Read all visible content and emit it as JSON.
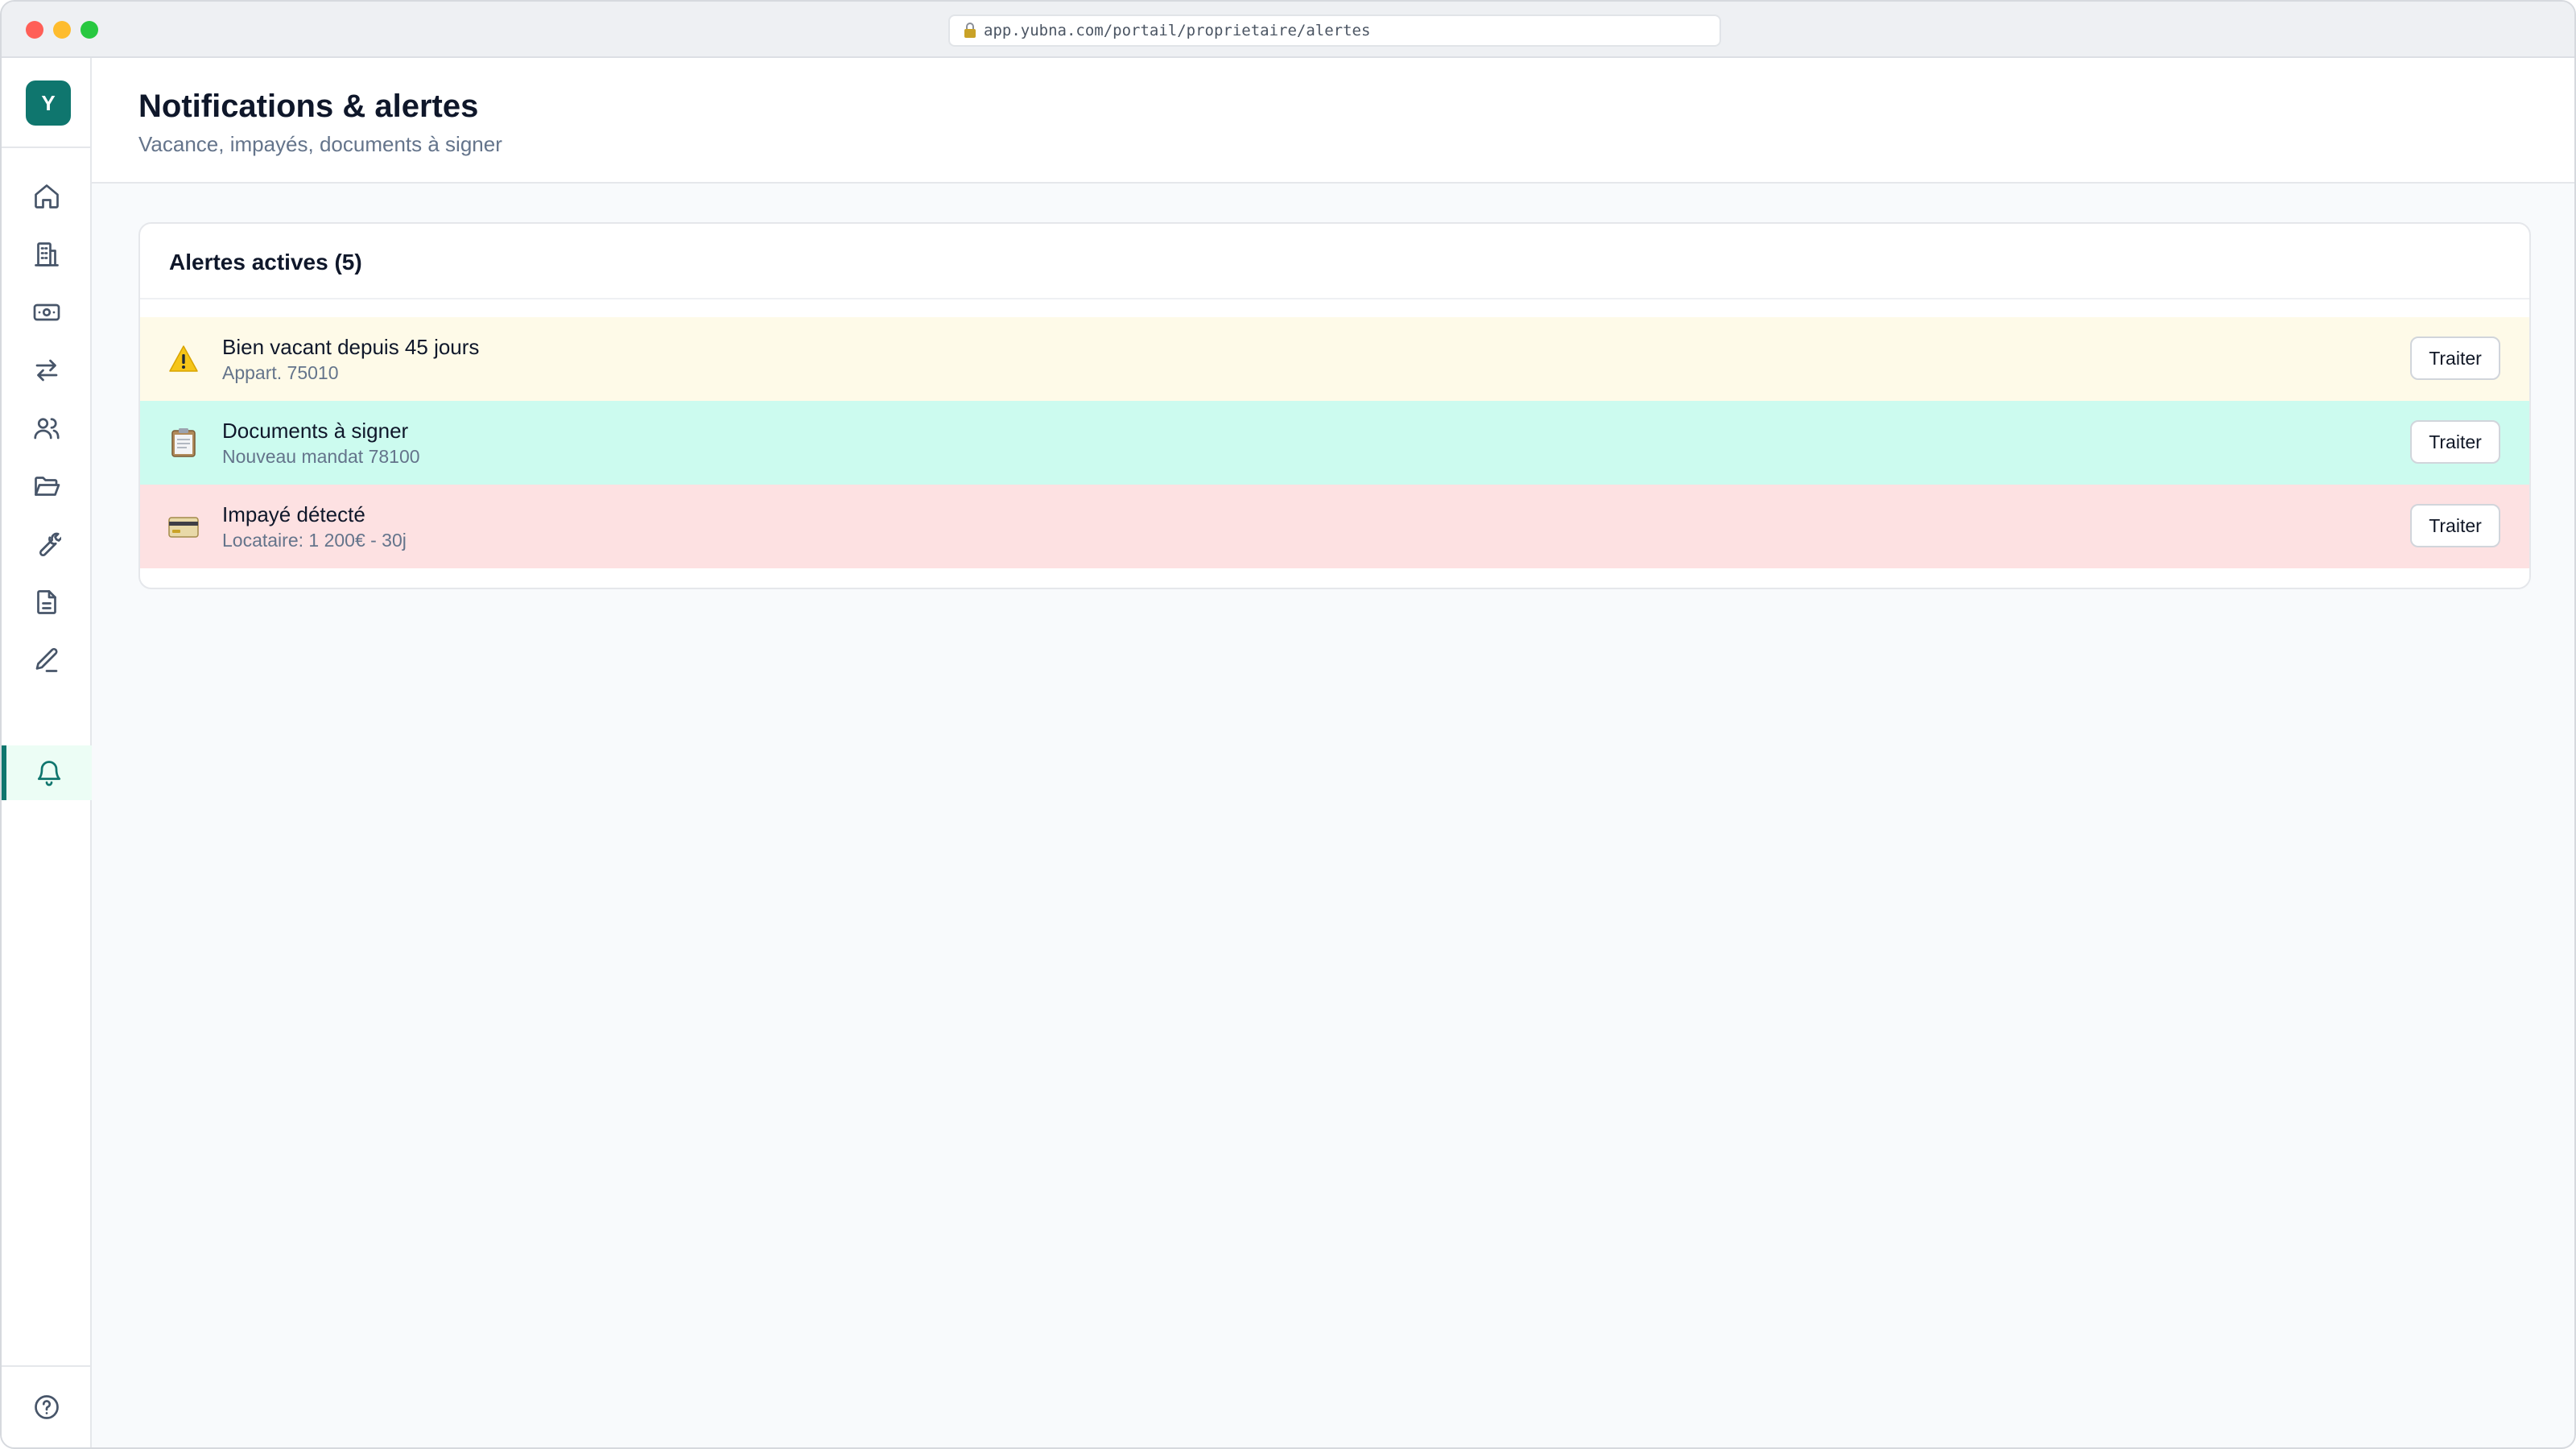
{
  "browser": {
    "url": "app.yubna.com/portail/proprietaire/alertes"
  },
  "sidebar": {
    "logo_letter": "Y",
    "items": [
      {
        "icon": "home-icon"
      },
      {
        "icon": "building-icon"
      },
      {
        "icon": "money-icon"
      },
      {
        "icon": "transfer-arrows-icon"
      },
      {
        "icon": "users-icon"
      },
      {
        "icon": "folder-icon"
      },
      {
        "icon": "wrench-icon"
      },
      {
        "icon": "document-icon"
      },
      {
        "icon": "pen-icon"
      },
      {
        "icon": "bell-icon",
        "active": true
      }
    ],
    "footer_icon": "help-icon",
    "accent_color": "#0f766e"
  },
  "header": {
    "title": "Notifications & alertes",
    "subtitle": "Vacance, impayés, documents à signer"
  },
  "card": {
    "title": "Alertes actives (5)",
    "alerts": [
      {
        "icon": "warning-icon",
        "title": "Bien vacant depuis 45 jours",
        "subtitle": "Appart. 75010",
        "action": "Traiter",
        "bg": "#fefae8"
      },
      {
        "icon": "clipboard-icon",
        "title": "Documents à signer",
        "subtitle": "Nouveau mandat 78100",
        "action": "Traiter",
        "bg": "#ccfbef"
      },
      {
        "icon": "credit-card-icon",
        "title": "Impayé détecté",
        "subtitle": "Locataire: 1 200€ - 30j",
        "action": "Traiter",
        "bg": "#fde1e2"
      }
    ]
  }
}
